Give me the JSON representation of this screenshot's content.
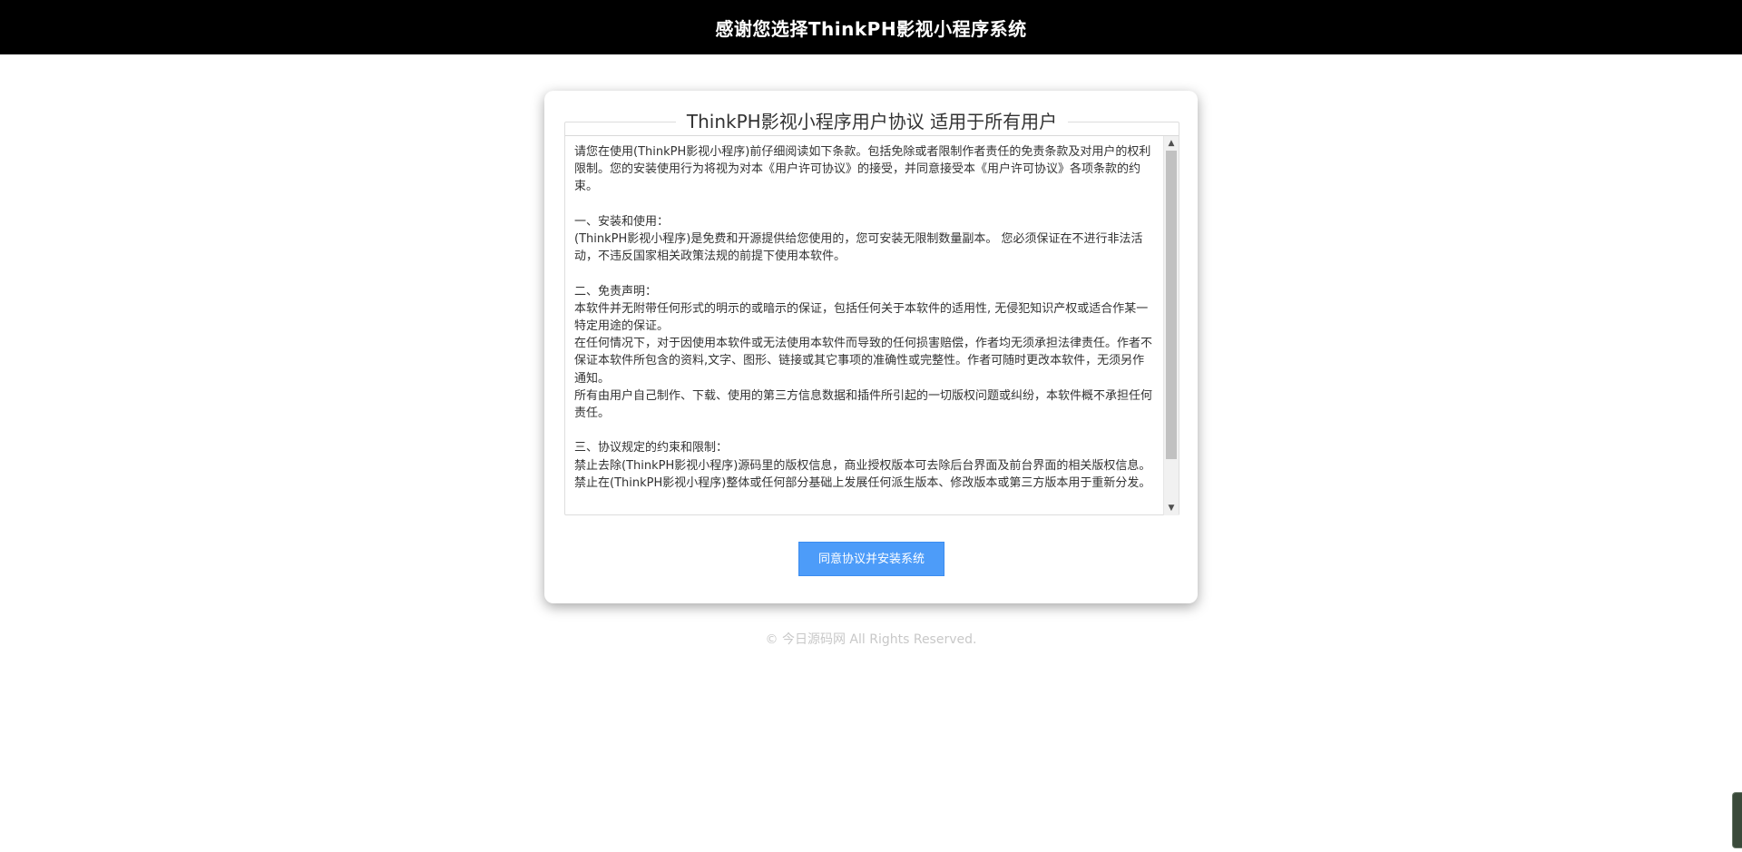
{
  "header": {
    "title": "感谢您选择ThinkPH影视小程序系统"
  },
  "agreement": {
    "legend": "ThinkPH影视小程序用户协议 适用于所有用户",
    "text": "请您在使用(ThinkPH影视小程序)前仔细阅读如下条款。包括免除或者限制作者责任的免责条款及对用户的权利限制。您的安装使用行为将视为对本《用户许可协议》的接受，并同意接受本《用户许可协议》各项条款的约束。\n\n一、安装和使用：\n(ThinkPH影视小程序)是免费和开源提供给您使用的，您可安装无限制数量副本。 您必须保证在不进行非法活动，不违反国家相关政策法规的前提下使用本软件。\n\n二、免责声明：\n本软件并无附带任何形式的明示的或暗示的保证，包括任何关于本软件的适用性, 无侵犯知识产权或适合作某一特定用途的保证。\n在任何情况下，对于因使用本软件或无法使用本软件而导致的任何损害赔偿，作者均无须承担法律责任。作者不保证本软件所包含的资料,文字、图形、链接或其它事项的准确性或完整性。作者可随时更改本软件，无须另作通知。\n所有由用户自己制作、下载、使用的第三方信息数据和插件所引起的一切版权问题或纠纷，本软件概不承担任何责任。\n\n三、协议规定的约束和限制：\n禁止去除(ThinkPH影视小程序)源码里的版权信息，商业授权版本可去除后台界面及前台界面的相关版权信息。\n禁止在(ThinkPH影视小程序)整体或任何部分基础上发展任何派生版本、修改版本或第三方版本用于重新分发。",
    "scroll_up_glyph": "▲",
    "scroll_down_glyph": "▼"
  },
  "actions": {
    "install_label": "同意协议并安装系统"
  },
  "footer": {
    "copyright": "© 今日源码网 All Rights Reserved."
  },
  "colors": {
    "header_bg": "#000000",
    "button_bg": "#4d9cf9",
    "footer_text": "#c8c8c8"
  }
}
